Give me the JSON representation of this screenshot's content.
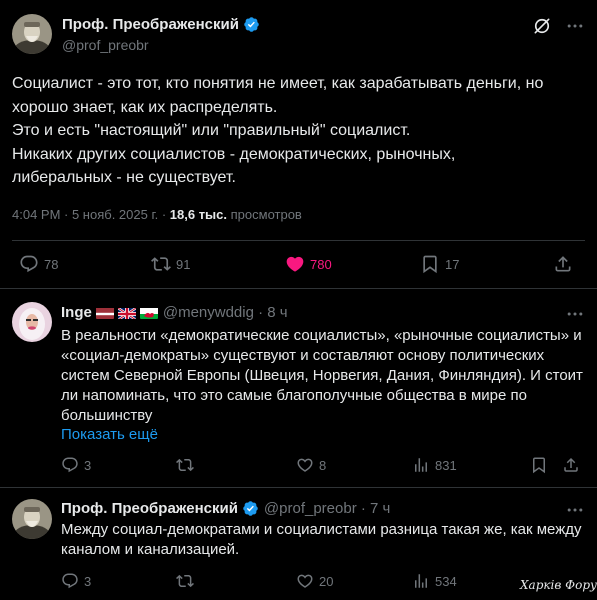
{
  "main_tweet": {
    "author_name": "Проф. Преображенский",
    "author_handle": "@prof_preobr",
    "text_lines": [
      "Социалист - это тот, кто понятия не имеет, как зарабатывать деньги, но",
      "хорошо знает, как их распределять.",
      "Это и есть \"настоящий\" или \"правильный\" социалист.",
      "Никаких других социалистов - демократических, рыночных,",
      "либеральных - не существует."
    ],
    "time": "4:04 PM · 5 нояб. 2025 г. · ",
    "views_count": "18,6 тыс.",
    "views_label": " просмотров",
    "stats": {
      "replies": "78",
      "reposts": "91",
      "likes": "780",
      "bookmarks": "17"
    }
  },
  "replies": [
    {
      "author_name": "Inge",
      "author_handle": "@menywddig · 8 ч",
      "text_lines": [
        "В реальности «демократические социалисты», «рыночные социалисты» и",
        "«социал-демократы» существуют и составляют основу политических",
        "систем Северной Европы (Швеция, Норвегия, Дания, Финляндия). И стоит",
        "ли напоминать, что это самые благополучные общества в мире по",
        "большинству"
      ],
      "show_more": "Показать ещё",
      "stats": {
        "replies": "3",
        "reposts": "",
        "likes": "8",
        "views": "831"
      }
    },
    {
      "author_name": "Проф. Преображенский",
      "author_handle": "@prof_preobr · 7 ч",
      "text_lines": [
        "Между социал-демократами и социалистами разница такая же, как между",
        "каналом и канализацией."
      ],
      "stats": {
        "replies": "3",
        "reposts": "",
        "likes": "20",
        "views": "534"
      }
    }
  ],
  "watermark": "Харків Форум",
  "colors": {
    "background": "#000000",
    "text": "#e7e9ea",
    "muted": "#71767b",
    "accent": "#1d9bf0",
    "like": "#f91880",
    "verified": "#1d9bf0"
  },
  "icons": [
    "grok-icon",
    "more-icon",
    "verified-icon",
    "reply-icon",
    "repost-icon",
    "like-icon",
    "bookmark-icon",
    "share-icon",
    "views-icon"
  ]
}
